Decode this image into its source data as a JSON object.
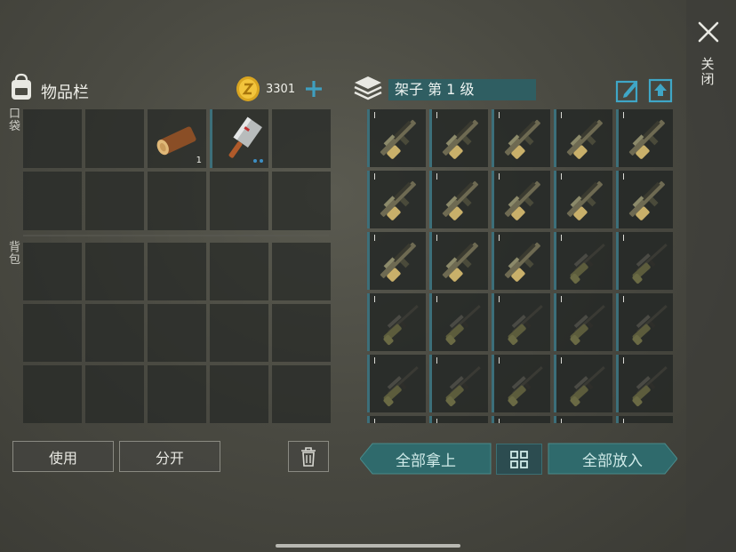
{
  "close": {
    "icon": "close-icon",
    "label": "关闭"
  },
  "inventory": {
    "title": "物品栏",
    "icon": "backpack-icon",
    "coins": "3301",
    "coin_icon": "coin-icon",
    "add_icon": "plus-icon",
    "pocket_label": "口袋",
    "bag_label": "背包",
    "pocket_slots": [
      {
        "item": "",
        "qty": ""
      },
      {
        "item": "",
        "qty": ""
      },
      {
        "item": "log",
        "qty": "1"
      },
      {
        "item": "cleaver",
        "qty": "",
        "selected": true,
        "dots": 2
      },
      {
        "item": "",
        "qty": ""
      },
      {
        "item": "",
        "qty": ""
      },
      {
        "item": "",
        "qty": ""
      },
      {
        "item": "",
        "qty": ""
      },
      {
        "item": "",
        "qty": ""
      },
      {
        "item": "",
        "qty": ""
      }
    ],
    "bag_slot_count": 15
  },
  "buttons": {
    "use": "使用",
    "split": "分开",
    "trash_icon": "trash-icon"
  },
  "shelf": {
    "icon": "shelf-icon",
    "name": "架子 第 1 级",
    "edit_icon": "edit-icon",
    "upload_icon": "upload-icon",
    "items": [
      {
        "type": "shotgun",
        "tier": "I"
      },
      {
        "type": "shotgun",
        "tier": "I"
      },
      {
        "type": "shotgun",
        "tier": "I"
      },
      {
        "type": "shotgun",
        "tier": "I"
      },
      {
        "type": "shotgun",
        "tier": "I"
      },
      {
        "type": "shotgun",
        "tier": "I"
      },
      {
        "type": "shotgun",
        "tier": "I"
      },
      {
        "type": "shotgun",
        "tier": "I"
      },
      {
        "type": "shotgun",
        "tier": "I"
      },
      {
        "type": "shotgun",
        "tier": "I"
      },
      {
        "type": "shotgun",
        "tier": "I"
      },
      {
        "type": "shotgun",
        "tier": "I"
      },
      {
        "type": "shotgun",
        "tier": "I"
      },
      {
        "type": "rifle",
        "tier": "I"
      },
      {
        "type": "rifle",
        "tier": "I"
      },
      {
        "type": "rifle",
        "tier": "I"
      },
      {
        "type": "rifle",
        "tier": "I"
      },
      {
        "type": "rifle",
        "tier": "I"
      },
      {
        "type": "rifle",
        "tier": "I"
      },
      {
        "type": "rifle",
        "tier": "I"
      },
      {
        "type": "rifle",
        "tier": "I"
      },
      {
        "type": "rifle",
        "tier": "I"
      },
      {
        "type": "rifle",
        "tier": "I"
      },
      {
        "type": "rifle",
        "tier": "I"
      },
      {
        "type": "rifle",
        "tier": "I"
      },
      {
        "type": "rifle",
        "tier": "I"
      },
      {
        "type": "rifle",
        "tier": "I"
      },
      {
        "type": "rifle",
        "tier": "I"
      },
      {
        "type": "rifle",
        "tier": "I"
      },
      {
        "type": "rifle",
        "tier": "I"
      }
    ],
    "take_all": "全部拿上",
    "sort_icon": "grid-sort-icon",
    "put_all": "全部放入"
  },
  "colors": {
    "accent": "#2f5e62",
    "slot": "#262826",
    "dot": "#3d8fc4"
  }
}
